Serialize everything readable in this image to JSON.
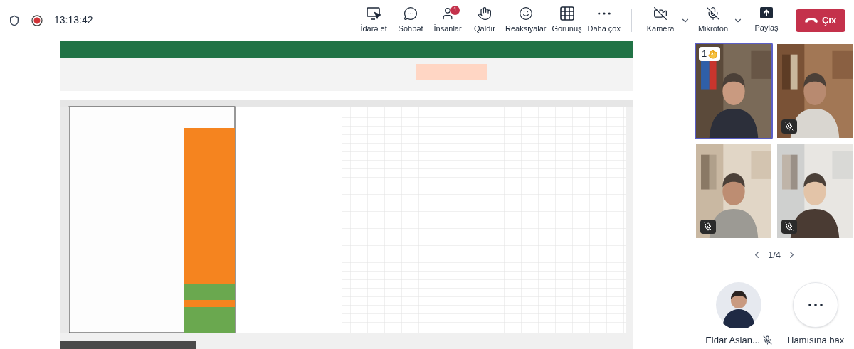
{
  "call_bar": {
    "time": "13:13:42",
    "actions": [
      {
        "kind": "manage",
        "label": "İdarə et"
      },
      {
        "kind": "chat",
        "label": "Söhbət"
      },
      {
        "kind": "people",
        "label": "İnsanlar",
        "badge": "1"
      },
      {
        "kind": "hand",
        "label": "Qaldır"
      },
      {
        "kind": "reactions",
        "label": "Reaksiyalar"
      },
      {
        "kind": "view",
        "label": "Görünüş"
      },
      {
        "kind": "more",
        "label": "Daha çox"
      }
    ],
    "devices": [
      {
        "kind": "camera",
        "label": "Kamera",
        "on": false
      },
      {
        "kind": "mic",
        "label": "Mikrofon",
        "on": false
      }
    ],
    "share": "Paylaş",
    "leave": "Çıx"
  },
  "participants": {
    "tiles": [
      {
        "highlighted": true,
        "muted": false,
        "hand_raised": true,
        "hand_order": "1"
      },
      {
        "highlighted": false,
        "muted": true,
        "hand_raised": false
      },
      {
        "highlighted": false,
        "muted": true,
        "hand_raised": false
      },
      {
        "highlighted": false,
        "muted": true,
        "hand_raised": false
      }
    ],
    "page": "1/4",
    "pinned": {
      "name": "Eldar Aslan...",
      "muted": true
    },
    "see_all": "Hamısına bax"
  }
}
